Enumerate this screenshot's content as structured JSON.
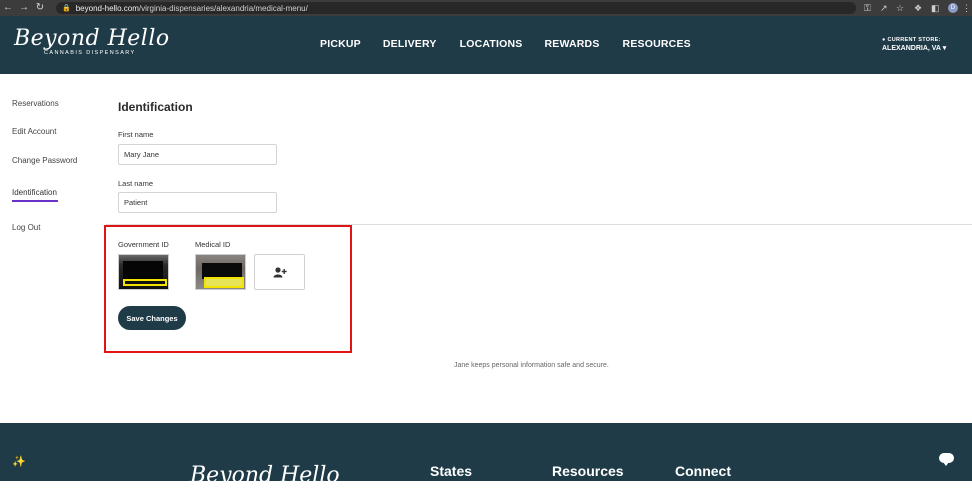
{
  "browser": {
    "url_host": "beyond-hello.com",
    "url_path": "/virginia-dispensaries/alexandria/medical-menu/",
    "profile_initial": "D"
  },
  "header": {
    "logo_script": "Beyond Hello",
    "logo_sub": "CANNABIS DISPENSARY",
    "nav": [
      "PICKUP",
      "DELIVERY",
      "LOCATIONS",
      "REWARDS",
      "RESOURCES"
    ],
    "store_label": "CURRENT STORE:",
    "store_value": "ALEXANDRIA, VA"
  },
  "sidebar": {
    "items": [
      "Reservations",
      "Edit Account",
      "Change Password",
      "Identification",
      "Log Out"
    ],
    "active_index": 3
  },
  "form": {
    "title": "Identification",
    "first_name_label": "First name",
    "first_name_value": "Mary Jane",
    "last_name_label": "Last name",
    "last_name_value": "Patient",
    "gov_id_label": "Government ID",
    "med_id_label": "Medical ID",
    "save_label": "Save Changes"
  },
  "secure_note": "Jane keeps personal information safe and secure.",
  "footer": {
    "logo_script": "Beyond Hello",
    "columns": [
      "States",
      "Resources",
      "Connect"
    ]
  },
  "colors": {
    "brand_dark": "#1f3b48",
    "active_underline": "#6a33c8",
    "highlight_red": "#e01414",
    "id_highlight_yellow": "#f2e400"
  }
}
